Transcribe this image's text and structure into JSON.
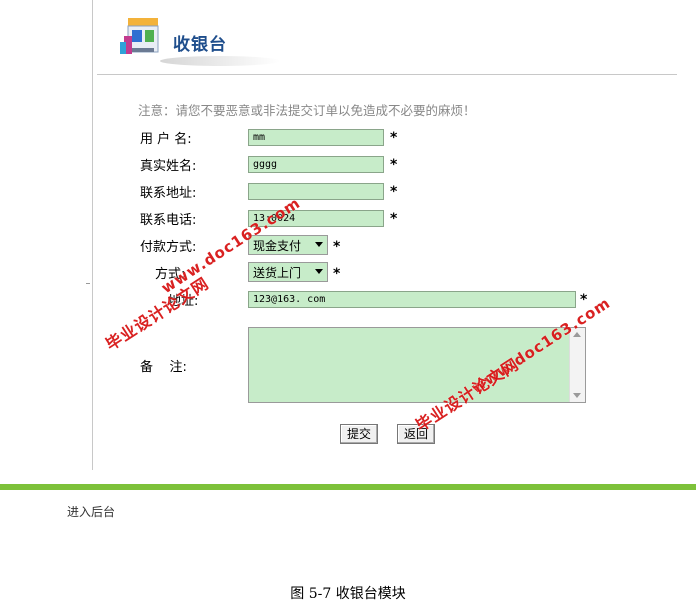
{
  "header": {
    "title": "收银台",
    "logo_icon": "cashier-shop-icon"
  },
  "notice": "注意：请您不要恶意或非法提交订单以免造成不必要的麻烦！",
  "form": {
    "username": {
      "label": "用 户 名:",
      "value": "mm"
    },
    "realname": {
      "label": "真实姓名:",
      "value": "gggg"
    },
    "address": {
      "label": "联系地址:",
      "value": ""
    },
    "phone": {
      "label": "联系电话:",
      "value": "13:0024"
    },
    "payment": {
      "label": "付款方式:",
      "selected": "现金支付"
    },
    "delivery": {
      "label": "方式:",
      "selected": "送货上门"
    },
    "email": {
      "label": "地址:",
      "value": "123@163. com"
    },
    "remark": {
      "label": "备    注:",
      "value": ""
    },
    "required_mark": "*"
  },
  "buttons": {
    "submit": "提交",
    "back": "返回"
  },
  "footer": {
    "admin_link": "进入后台"
  },
  "caption": "图 5-7  收银台模块",
  "watermarks": {
    "site1": "www.doc163.com",
    "cn1": "毕业设计论文网",
    "site2": "www.doc163.com",
    "cn2": "毕业设计论文网"
  },
  "colors": {
    "field_bg": "#c7ecc9",
    "accent_green": "#7dc13a",
    "title_blue": "#1f4e8c",
    "watermark_red": "#d81616"
  }
}
